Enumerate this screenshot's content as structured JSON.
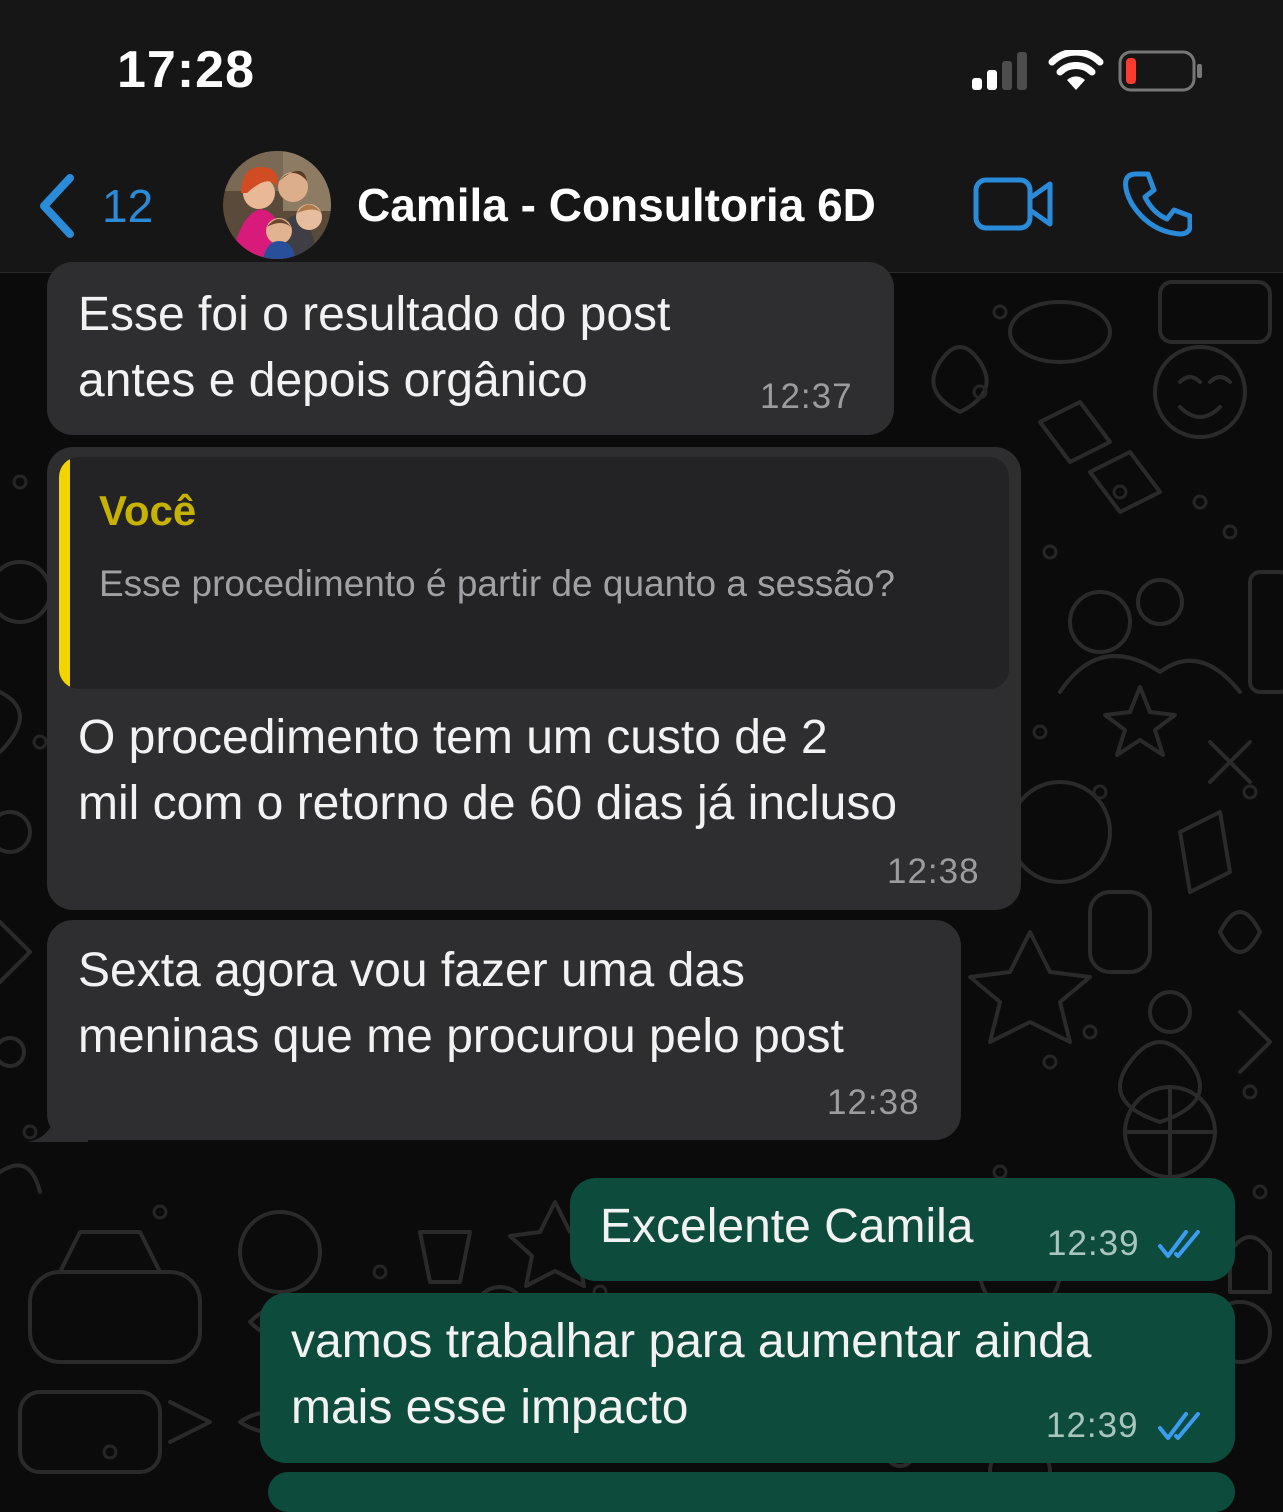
{
  "status_bar": {
    "time": "17:28"
  },
  "header": {
    "back_count": "12",
    "contact_name": "Camila - Consultoria 6D",
    "accent_color": "#2a8bd8"
  },
  "messages": [
    {
      "direction": "incoming",
      "text": "Esse foi o resultado do post\nantes e depois orgânico",
      "time": "12:37"
    },
    {
      "direction": "incoming",
      "quote": {
        "author": "Você",
        "text": "Esse procedimento é partir de quanto a sessão?"
      },
      "text": "O procedimento tem um custo de 2\nmil com o retorno de 60 dias já incluso",
      "time": "12:38"
    },
    {
      "direction": "incoming",
      "text": "Sexta agora vou fazer uma das\nmeninas que me procurou pelo post",
      "time": "12:38"
    },
    {
      "direction": "outgoing",
      "text": "Excelente Camila",
      "time": "12:39",
      "status": "read"
    },
    {
      "direction": "outgoing",
      "text": "vamos trabalhar para aumentar ainda\nmais esse impacto",
      "time": "12:39",
      "status": "read"
    }
  ],
  "colors": {
    "incoming_bubble": "#2e2e30",
    "outgoing_bubble": "#0d4b3c",
    "quote_bar": "#f2d500",
    "read_ticks": "#3b9cf0"
  },
  "icons": {
    "back": "chevron-left-icon",
    "video": "video-camera-icon",
    "call": "phone-icon",
    "signal": "cellular-signal-icon",
    "wifi": "wifi-icon",
    "battery": "battery-low-icon",
    "read": "double-check-icon"
  }
}
